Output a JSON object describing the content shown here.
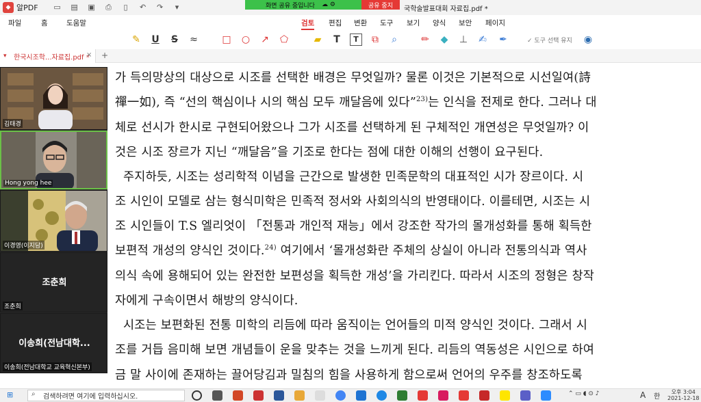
{
  "titlebar": {
    "app_name": "알PDF",
    "share_text": "화면 공유 중입니다",
    "share_stop": "공유 중지",
    "doc_title": "국학술발표대회 자료집.pdf *"
  },
  "menu_left": [
    "파일",
    "홈",
    "도움말"
  ],
  "menu_tabs": [
    "검토",
    "편집",
    "변환",
    "도구",
    "보기",
    "양식",
    "보안",
    "페이지"
  ],
  "toolbar": {
    "keep_tool": "도구 선택 유지"
  },
  "tab": {
    "label": "한국시조학...자료집.pdf *",
    "close": "×",
    "add": "+"
  },
  "document": {
    "lines": [
      "가 득의망상의 대상으로 시조를 선택한 배경은 무엇일까? 물론 이것은 기본적으로 시선일여(詩",
      "禪一如), 즉 “선의 핵심이나 시의 핵심 모두 깨달음에 있다”",
      "체로 선시가 한시로 구현되어왔으나 그가 시조를 선택하게 된 구체적인 개연성은 무엇일까? 이",
      "것은 시조 장르가 지닌 “깨달음”을 기조로 한다는 점에 대한 이해의 선행이 요구된다.",
      "주지하듯, 시조는 성리학적 이념을 근간으로 발생한 민족문학의 대표적인 시가 장르이다.  시",
      "조 시인이 모델로 삼는 형식미학은 민족적 정서와 사회의식의 반영태이다. 이를테면, 시조는 시",
      "조 시인들이 T.S 엘리엇이 「전통과 개인적 재능」에서 강조한 작가의 몰개성화를 통해 획득한",
      "보편적 개성의 양식인 것이다.",
      "의식 속에 용해되어 있는 완전한 보편성을 획득한 개성’을 가리킨다. 따라서 시조의 정형은 창작",
      "자에게 구속이면서 해방의 양식이다.",
      "시조는 보편화된 전통 미학의 리듬에 따라 움직이는 언어들의 미적 양식인 것이다. 그래서 시",
      "조를 거듭 음미해 보면 개념들이 운을 맞추는 것을 느끼게 된다. 리듬의 역동성은 시인으로 하여",
      "금 말 사이에 존재하는 끌어당김과 밀침의 힘을 사용하게 함으로써 언어의 우주를 창조하도록"
    ],
    "line2_sup": "23)",
    "line2_tail": "는 인식을 전제로 한다. 그러나 대",
    "line8_sup": "24)",
    "line8_tail": " 여기에서 ‘몰개성화란 주체의 상실이 아니라 전통의식과 역사"
  },
  "participants": [
    {
      "name": "김태경"
    },
    {
      "name": "Hong yong hee"
    },
    {
      "name": "이경영(이지담)"
    },
    {
      "name": "조춘희",
      "big": "조춘희"
    },
    {
      "name": "이송희(전남대학교 교육혁신본부)",
      "big": "이송희(전남대학..."
    }
  ],
  "taskbar": {
    "search_placeholder": "검색하려면 여기에 입력하십시오.",
    "time": "오후 3:04",
    "date": "2021-12-18",
    "ime": "A",
    "ime2": "한"
  },
  "colors": {
    "accent": "#d33333",
    "share_green": "#3cc14a",
    "stop_red": "#e53935"
  }
}
